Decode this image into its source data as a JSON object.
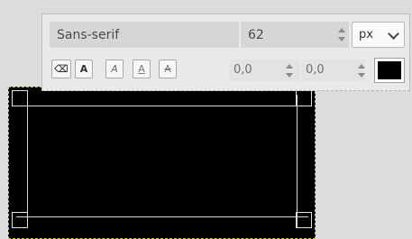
{
  "text_toolbox": {
    "font": {
      "value": "Sans-serif"
    },
    "size": {
      "value": "62"
    },
    "unit": {
      "selected": "px"
    },
    "style_buttons": [
      {
        "name": "clear-style",
        "glyph": "⌫"
      },
      {
        "name": "bold",
        "glyph": "A"
      },
      {
        "name": "italic",
        "glyph": "A"
      },
      {
        "name": "underline",
        "glyph": "A"
      },
      {
        "name": "strikethrough",
        "glyph": "A"
      }
    ],
    "baseline_offset": {
      "value": "0,0"
    },
    "kerning": {
      "value": "0,0"
    },
    "text_color": "#000000"
  },
  "canvas": {
    "layer_color": "#000000"
  }
}
